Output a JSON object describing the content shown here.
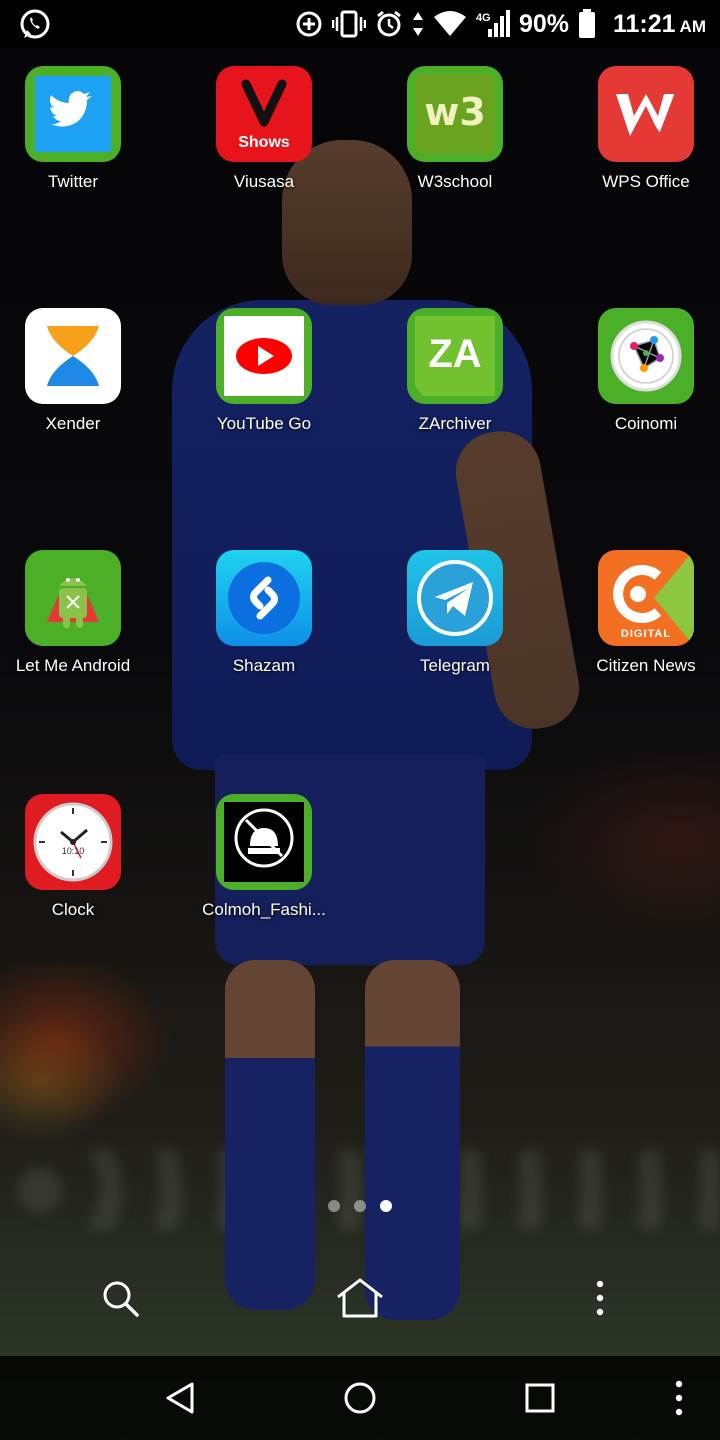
{
  "status_bar": {
    "left_icons": [
      "whatsapp-icon"
    ],
    "right_icons": [
      "data-saver-icon",
      "vibrate-icon",
      "alarm-icon",
      "data-arrows-icon",
      "wifi-icon",
      "signal-4g-icon",
      "battery-icon"
    ],
    "network_label": "4G",
    "battery_percent": "90%",
    "time": "11:21",
    "ampm": "AM"
  },
  "apps": [
    {
      "label": "Twitter"
    },
    {
      "label": "Viusasa",
      "icon_text": "Shows"
    },
    {
      "label": "W3school",
      "icon_text": "w3"
    },
    {
      "label": "WPS Office"
    },
    {
      "label": "Xender"
    },
    {
      "label": "YouTube Go"
    },
    {
      "label": "ZArchiver",
      "icon_text": "ZA"
    },
    {
      "label": "Coinomi"
    },
    {
      "label": "Let Me Android"
    },
    {
      "label": "Shazam"
    },
    {
      "label": "Telegram"
    },
    {
      "label": "Citizen News",
      "icon_text": "DIGITAL"
    },
    {
      "label": "Clock",
      "icon_text": "10:10"
    },
    {
      "label": "Colmoh_Fashi..."
    }
  ],
  "page_indicator": {
    "pages": 3,
    "active_index": 2
  },
  "dock": {
    "icons": [
      "search-icon",
      "home-icon",
      "more-vertical-icon"
    ]
  },
  "nav_bar": {
    "icons": [
      "back-icon",
      "home-circle-icon",
      "recents-icon",
      "more-vertical-icon"
    ]
  },
  "colors": {
    "twitter": "#1da1f2",
    "viusasa": "#e8141b",
    "w3school": "#4caf28",
    "wps": "#e53935",
    "xender": "#1e88e5",
    "youtube": "#ff0000",
    "zarchiver": "#5db12a",
    "coinomi": "#4caf28",
    "shazam": "#0f8fe8",
    "telegram": "#2aa1d8",
    "citizen": "#f36f21",
    "clock": "#e11b22"
  }
}
